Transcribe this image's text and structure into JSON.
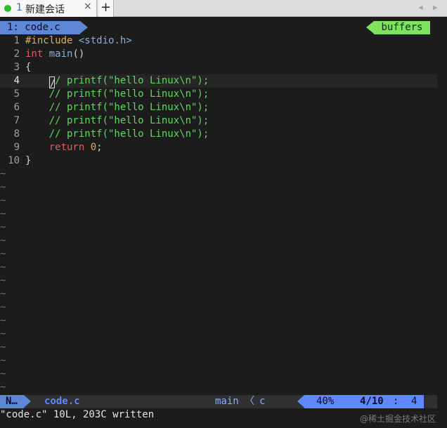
{
  "terminal": {
    "tab": {
      "number": "1",
      "title": "新建会话",
      "close": "×"
    },
    "new_tab": "+",
    "scroll_left": "◀",
    "scroll_right": "▶"
  },
  "tabline": {
    "left": "1: code.c",
    "right": "buffers"
  },
  "editor": {
    "lines": [
      {
        "num": "1",
        "tokens": [
          {
            "cls": "tok-preproc",
            "text": "#include"
          },
          {
            "cls": "",
            "text": " "
          },
          {
            "cls": "tok-header",
            "text": "<stdio.h>"
          }
        ]
      },
      {
        "num": "2",
        "tokens": [
          {
            "cls": "tok-type",
            "text": "int"
          },
          {
            "cls": "",
            "text": " "
          },
          {
            "cls": "tok-func",
            "text": "main"
          },
          {
            "cls": "",
            "text": "()"
          }
        ]
      },
      {
        "num": "3",
        "tokens": [
          {
            "cls": "",
            "text": "{"
          }
        ]
      },
      {
        "num": "4",
        "current": true,
        "tokens": [
          {
            "cls": "",
            "text": "    "
          },
          {
            "cls": "cursor",
            "text": "/"
          },
          {
            "cls": "tok-comment",
            "text": "/ printf(\"hello Linux\\n\");"
          }
        ]
      },
      {
        "num": "5",
        "tokens": [
          {
            "cls": "",
            "text": "    "
          },
          {
            "cls": "tok-comment",
            "text": "// printf(\"hello Linux\\n\");"
          }
        ]
      },
      {
        "num": "6",
        "tokens": [
          {
            "cls": "",
            "text": "    "
          },
          {
            "cls": "tok-comment",
            "text": "// printf(\"hello Linux\\n\");"
          }
        ]
      },
      {
        "num": "7",
        "tokens": [
          {
            "cls": "",
            "text": "    "
          },
          {
            "cls": "tok-comment",
            "text": "// printf(\"hello Linux\\n\");"
          }
        ]
      },
      {
        "num": "8",
        "tokens": [
          {
            "cls": "",
            "text": "    "
          },
          {
            "cls": "tok-comment",
            "text": "// printf(\"hello Linux\\n\");"
          }
        ]
      },
      {
        "num": "9",
        "tokens": [
          {
            "cls": "",
            "text": "    "
          },
          {
            "cls": "tok-keyword",
            "text": "return"
          },
          {
            "cls": "",
            "text": " "
          },
          {
            "cls": "tok-number",
            "text": "0"
          },
          {
            "cls": "",
            "text": ";"
          }
        ]
      },
      {
        "num": "10",
        "tokens": [
          {
            "cls": "",
            "text": "}"
          }
        ]
      }
    ],
    "filler": "~",
    "filler_count": 17
  },
  "statusline": {
    "mode": "N…",
    "file": "code.c",
    "function": "main",
    "separator": "〈",
    "filetype": "c",
    "percent": "40%",
    "position": "4/10",
    "colon": ":",
    "column": "4"
  },
  "cmdline": "\"code.c\" 10L, 203C written",
  "watermark": "@稀土掘金技术社区"
}
